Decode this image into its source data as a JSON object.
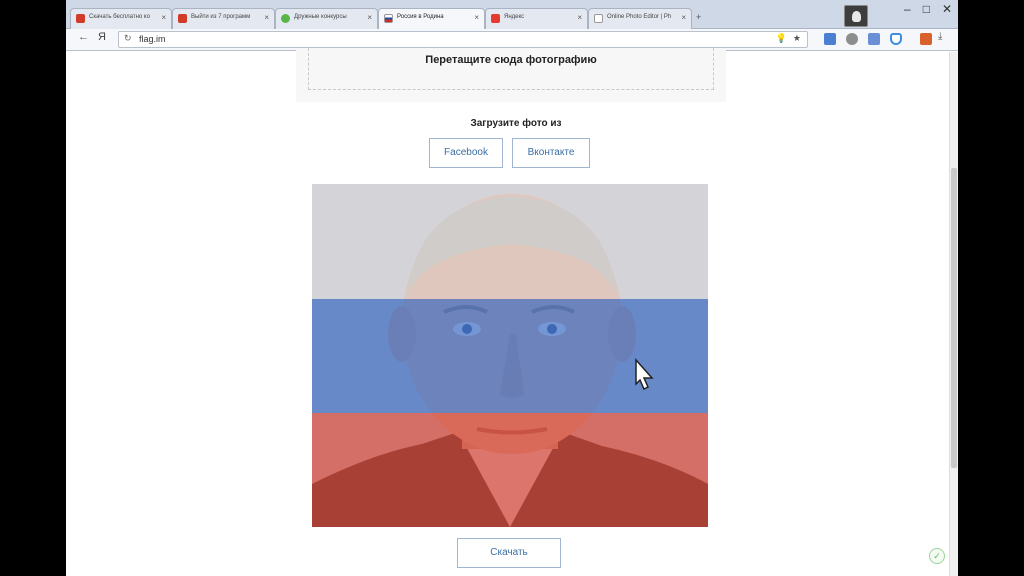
{
  "tabs": [
    {
      "label": "Скачать бесплатно ко",
      "color": "#d23a2a"
    },
    {
      "label": "Выйти из 7 программ",
      "color": "#d23a2a"
    },
    {
      "label": "Дружные конкурсы",
      "color": "#59b548"
    },
    {
      "label": "Россия в Родина",
      "color": "#1f4fa8",
      "active": true
    },
    {
      "label": "Яндекс",
      "color": "#e63a2e"
    },
    {
      "label": "Online Photo Editor | Ph",
      "color": "#888888"
    }
  ],
  "toolbar": {
    "back": "←",
    "yandex": "Я",
    "reload": "↻",
    "url": "flag.im",
    "bulb": "💡",
    "star": "★",
    "download": "⤓"
  },
  "window_controls": {
    "minimize": "–",
    "maximize": "□",
    "close": "✕"
  },
  "page": {
    "dropzone_label": "Перетащите сюда фотографию",
    "upload_title": "Загрузите фото из",
    "facebook_button": "Facebook",
    "vk_button": "Вконтакте",
    "download_button": "Скачать"
  },
  "flag": {
    "white": "#d9dadd",
    "blue": "#3e6dc3",
    "red": "#d44a3c"
  }
}
